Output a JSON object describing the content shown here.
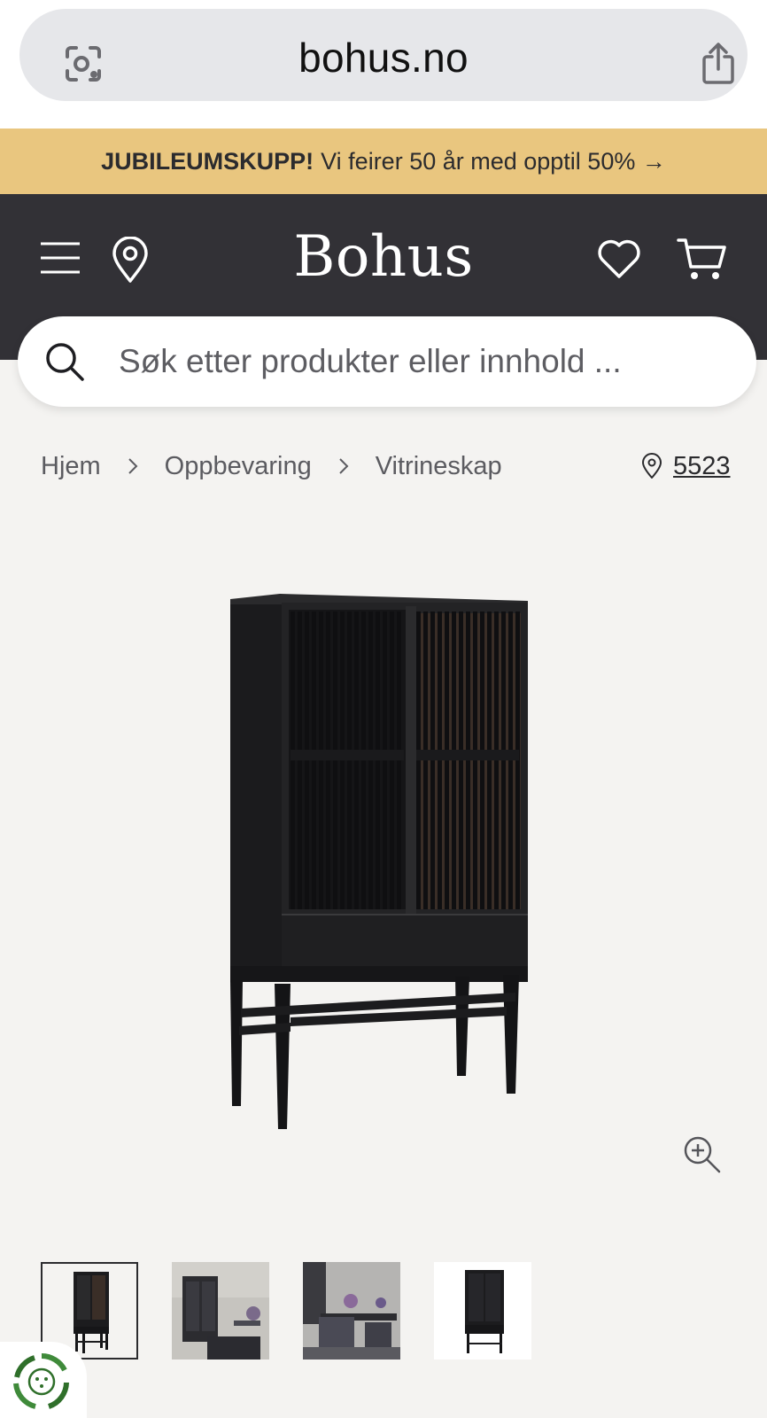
{
  "browser": {
    "url": "bohus.no"
  },
  "promo": {
    "bold_text": "JUBILEUMSKUPP!",
    "text": "Vi feirer 50 år med opptil 50% →"
  },
  "header": {
    "logo": "Bohus"
  },
  "search": {
    "placeholder": "Søk etter produkter eller innhold ..."
  },
  "breadcrumb": {
    "items": [
      "Hjem",
      "Oppbevaring",
      "Vitrineskap"
    ]
  },
  "store": {
    "number": "5523"
  },
  "colors": {
    "promo_bg": "#e9c67f",
    "header_bg": "#323136",
    "page_bg": "#f4f3f1"
  },
  "thumbnails": {
    "count": 4,
    "selected_index": 0
  }
}
